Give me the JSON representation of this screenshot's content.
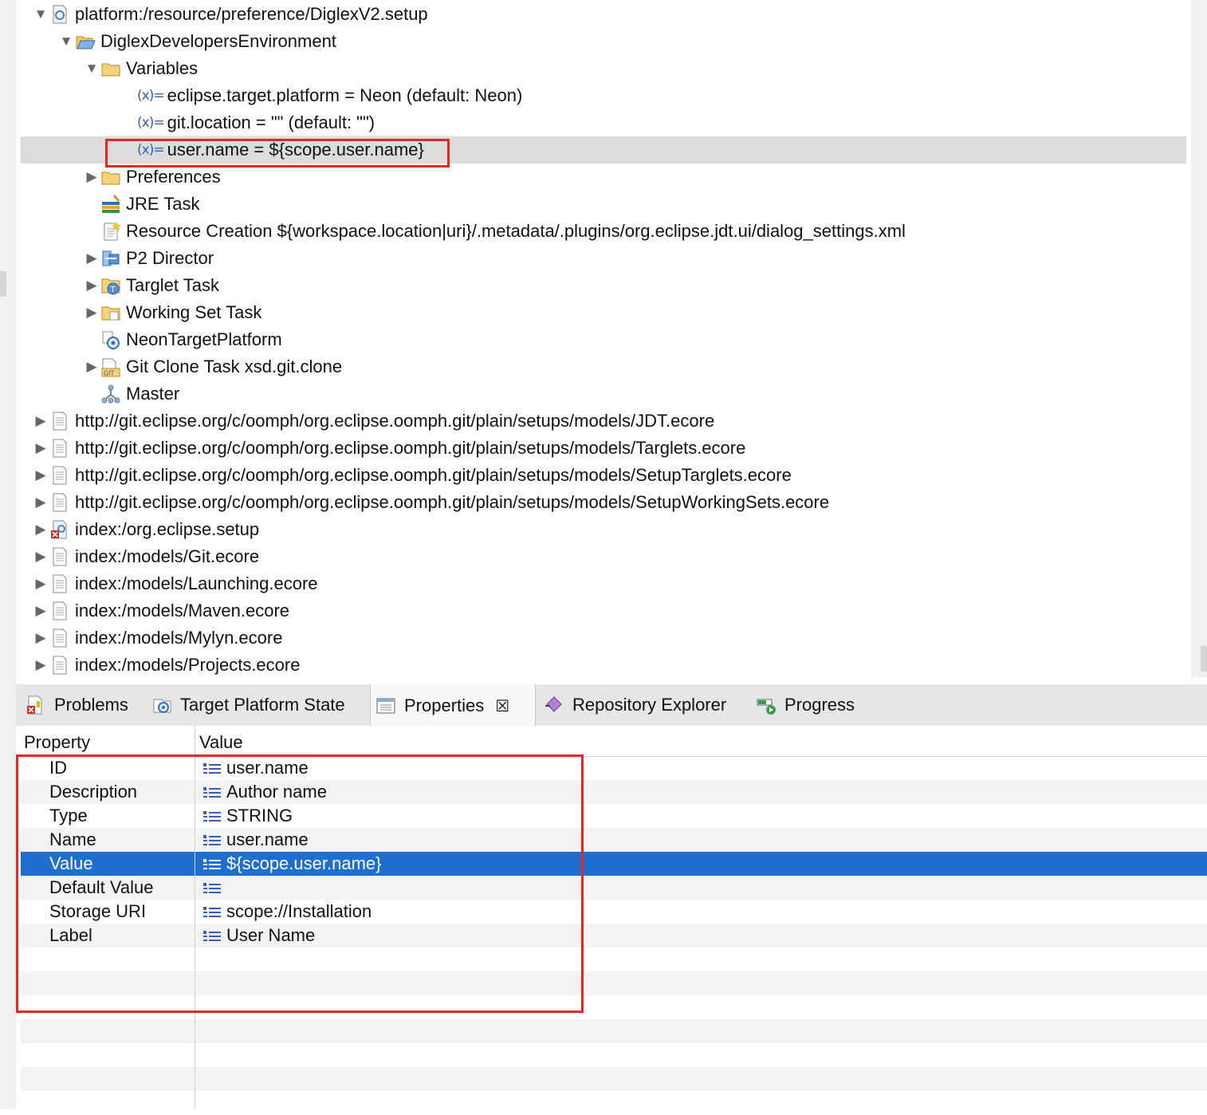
{
  "tree": {
    "rows": [
      {
        "label": "platform:/resource/preference/DiglexV2.setup",
        "twisty": "expanded",
        "icon": "setup-file-icon",
        "depth": 0
      },
      {
        "label": "DiglexDevelopersEnvironment",
        "twisty": "expanded",
        "icon": "open-folder-icon",
        "depth": 1
      },
      {
        "label": "Variables",
        "twisty": "expanded",
        "icon": "folder-icon",
        "depth": 2
      },
      {
        "label": "eclipse.target.platform = Neon (default: Neon)",
        "twisty": "none",
        "icon": "variable-icon",
        "depth": 3
      },
      {
        "label": "git.location = \"\" (default: \"\")",
        "twisty": "none",
        "icon": "variable-icon",
        "depth": 3
      },
      {
        "label": "user.name = ${scope.user.name}",
        "twisty": "none",
        "icon": "variable-icon",
        "depth": 3,
        "selected": true
      },
      {
        "label": "Preferences",
        "twisty": "collapsed",
        "icon": "folder-icon",
        "depth": 2
      },
      {
        "label": "JRE Task",
        "twisty": "none",
        "icon": "jre-task-icon",
        "depth": 2
      },
      {
        "label": "Resource Creation ${workspace.location|uri}/.metadata/.plugins/org.eclipse.jdt.ui/dialog_settings.xml",
        "twisty": "none",
        "icon": "resource-creation-icon",
        "depth": 2
      },
      {
        "label": "P2 Director",
        "twisty": "collapsed",
        "icon": "p2-director-icon",
        "depth": 2
      },
      {
        "label": "Targlet Task",
        "twisty": "collapsed",
        "icon": "targlet-task-icon",
        "depth": 2
      },
      {
        "label": "Working Set Task",
        "twisty": "collapsed",
        "icon": "working-set-icon",
        "depth": 2
      },
      {
        "label": "NeonTargetPlatform",
        "twisty": "none",
        "icon": "target-platform-icon",
        "depth": 2
      },
      {
        "label": "Git Clone Task xsd.git.clone",
        "twisty": "collapsed",
        "icon": "git-clone-icon",
        "depth": 2
      },
      {
        "label": "Master",
        "twisty": "none",
        "icon": "master-icon",
        "depth": 2
      },
      {
        "label": "http://git.eclipse.org/c/oomph/org.eclipse.oomph.git/plain/setups/models/JDT.ecore",
        "twisty": "collapsed",
        "icon": "document-icon",
        "depth": 0
      },
      {
        "label": "http://git.eclipse.org/c/oomph/org.eclipse.oomph.git/plain/setups/models/Targlets.ecore",
        "twisty": "collapsed",
        "icon": "document-icon",
        "depth": 0
      },
      {
        "label": "http://git.eclipse.org/c/oomph/org.eclipse.oomph.git/plain/setups/models/SetupTarglets.ecore",
        "twisty": "collapsed",
        "icon": "document-icon",
        "depth": 0
      },
      {
        "label": "http://git.eclipse.org/c/oomph/org.eclipse.oomph.git/plain/setups/models/SetupWorkingSets.ecore",
        "twisty": "collapsed",
        "icon": "document-icon",
        "depth": 0
      },
      {
        "label": "index:/org.eclipse.setup",
        "twisty": "collapsed",
        "icon": "setup-error-icon",
        "depth": 0
      },
      {
        "label": "index:/models/Git.ecore",
        "twisty": "collapsed",
        "icon": "document-icon",
        "depth": 0
      },
      {
        "label": "index:/models/Launching.ecore",
        "twisty": "collapsed",
        "icon": "document-icon",
        "depth": 0
      },
      {
        "label": "index:/models/Maven.ecore",
        "twisty": "collapsed",
        "icon": "document-icon",
        "depth": 0
      },
      {
        "label": "index:/models/Mylyn.ecore",
        "twisty": "collapsed",
        "icon": "document-icon",
        "depth": 0
      },
      {
        "label": "index:/models/Projects.ecore",
        "twisty": "collapsed",
        "icon": "document-icon",
        "depth": 0
      }
    ]
  },
  "tabs": [
    {
      "label": "Problems",
      "icon": "problems-icon"
    },
    {
      "label": "Target Platform State",
      "icon": "target-platform-state-icon"
    },
    {
      "label": "Properties",
      "icon": "properties-icon",
      "active": true,
      "close": "☒"
    },
    {
      "label": "Repository Explorer",
      "icon": "repository-explorer-icon"
    },
    {
      "label": "Progress",
      "icon": "progress-icon"
    }
  ],
  "properties": {
    "header": {
      "property": "Property",
      "value": "Value"
    },
    "rows": [
      {
        "property": "ID",
        "value": "user.name"
      },
      {
        "property": "Description",
        "value": "Author name"
      },
      {
        "property": "Type",
        "value": "STRING"
      },
      {
        "property": "Name",
        "value": "user.name"
      },
      {
        "property": "Value",
        "value": "${scope.user.name}",
        "selected": true
      },
      {
        "property": "Default Value",
        "value": ""
      },
      {
        "property": "Storage URI",
        "value": "scope://Installation"
      },
      {
        "property": "Label",
        "value": "User Name"
      }
    ]
  },
  "colors": {
    "highlight": "#e8261f",
    "selection": "#1f6fd1"
  }
}
